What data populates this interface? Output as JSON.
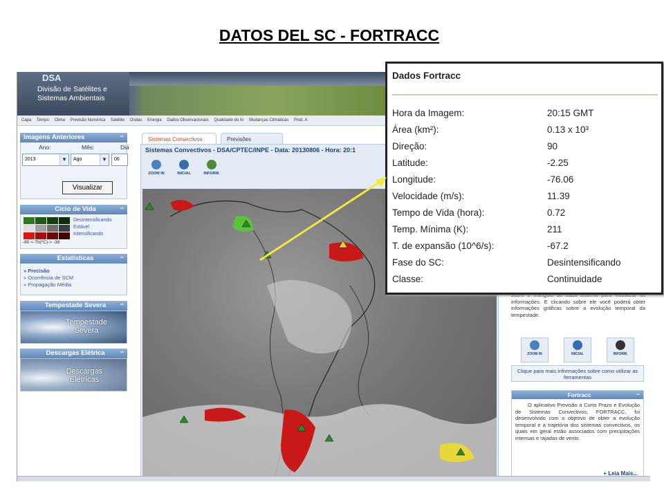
{
  "slide_title": "DATOS DEL SC - FORTRACC",
  "banner": {
    "org": "DSA",
    "org_line1": "Divisão de Satélites e",
    "org_line2": "Sistemas Ambientais"
  },
  "nav": [
    "Capa",
    "Tempo",
    "Clima",
    "Previsão Numérica",
    "Satélite",
    "Ondas",
    "Energia",
    "Dados Observacionais",
    "Qualidade do Ar",
    "Mudanças Climáticas",
    "Prod. A"
  ],
  "sidebar": {
    "images": {
      "title": "Imagens Anteriores",
      "year_label": "Ano:",
      "month_label": "Mês:",
      "day_label": "Dia",
      "year_value": "2013",
      "month_value": "Ago",
      "day_value": "06",
      "button": "Visualizar"
    },
    "ciclo": {
      "title": "Ciclo de Vida",
      "legend": [
        "Desintensificando",
        "Estável",
        "Intensificando"
      ],
      "scale": "-80 <-Tb(ºC)-> -38",
      "colors": [
        "#2e7a1e",
        "#1e5a14",
        "#144010",
        "#0c2c0a",
        "#dcdcdc",
        "#a0a0a0",
        "#6e6e6e",
        "#3c3c3c",
        "#d81818",
        "#a81010",
        "#700808",
        "#400404"
      ]
    },
    "stats": {
      "title": "Estatísticas",
      "items": [
        "» Precisão",
        "» Ocorrência de SCM",
        "» Propagação Média"
      ]
    },
    "tempestade": {
      "title": "Tempestade Severa",
      "img_text": "Tempestade Severa"
    },
    "descargas": {
      "title": "Descargas Elétrica",
      "img_text": "Descargas Elétricas"
    }
  },
  "main": {
    "tab_active": "Sistemas Convectivos",
    "tab_other": "Previsões",
    "panel_title": "Sistemas Convectivos - DSA/CPTEC/INPE - Data: 20130806 - Hora: 20:1",
    "tools": [
      "ZOOM IN",
      "INICIAL",
      "INFORM."
    ]
  },
  "right": {
    "text": "sobre o triângulo de cada sistema para visualizar as informações. E clicando sobre ele você poderá obter informações gráficas sobre a evolução temporal da tempestade.",
    "tools": [
      "ZOOM IN",
      "INICIAL",
      "INFORM."
    ],
    "help": "Clique para mais informações sobre como utilizar as ferramentas",
    "fortracc_title": "Fortracc",
    "fortracc_desc": "O aplicativo Previsão a Curto Prazo e Evolução de Sistemas Convectivos, FORTRACC, foi desenvolvido com o objetivo de obter a evolução temporal e a trajetória dos sistemas convectivos, os quais em geral estão associados com precipitações intensas e rajadas de vento.",
    "leia_mais": "+ Leia Mais..."
  },
  "popup": {
    "title": "Dados Fortracc",
    "rows": [
      {
        "label": "Hora da Imagem:",
        "value": "20:15 GMT"
      },
      {
        "label": "Área (km²):",
        "value": "0.13 x 10³"
      },
      {
        "label": "Direção:",
        "value": "90"
      },
      {
        "label": "Latitude:",
        "value": "-2.25"
      },
      {
        "label": "Longitude:",
        "value": "-76.06"
      },
      {
        "label": "Velocidade (m/s):",
        "value": "11.39"
      },
      {
        "label": "Tempo de Vida (hora):",
        "value": "0.72"
      },
      {
        "label": "Temp. Mínima (K):",
        "value": "211"
      },
      {
        "label": "T. de expansão (10^6/s):",
        "value": "-67.2"
      },
      {
        "label": "Fase do SC:",
        "value": "Desintensificando"
      },
      {
        "label": "Classe:",
        "value": "Continuidade"
      }
    ]
  },
  "colors": {
    "arrow": "#f5e83a",
    "accent": "#1a3f7a"
  }
}
